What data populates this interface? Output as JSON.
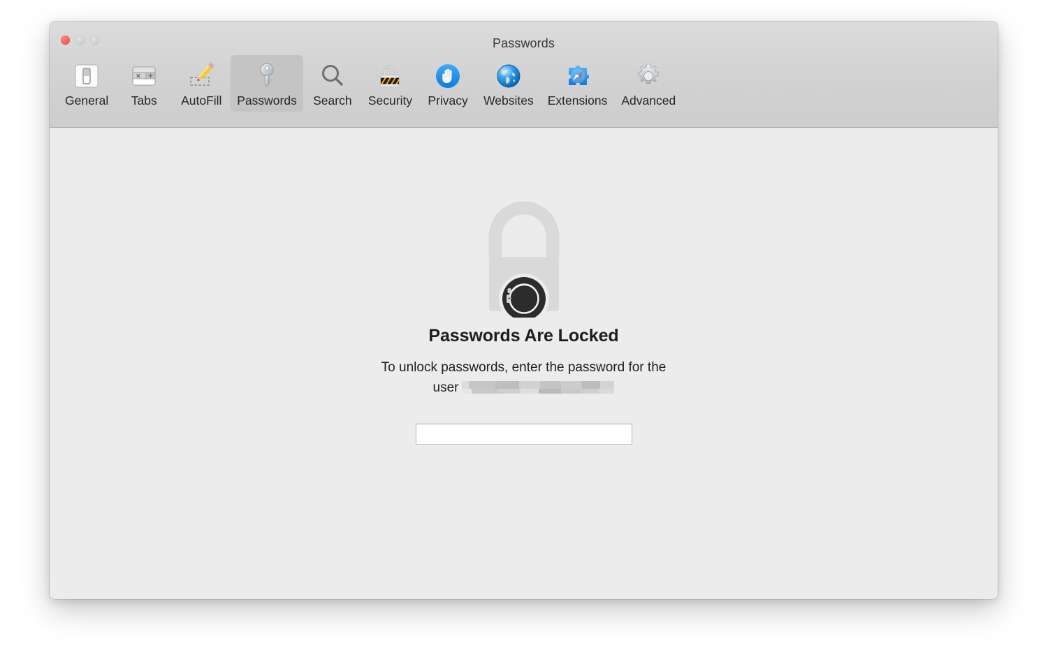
{
  "window": {
    "title": "Passwords",
    "traffic_lights": [
      {
        "name": "close",
        "color": "#ff5f57",
        "enabled": true
      },
      {
        "name": "minimize",
        "color": "#d2d2d2",
        "enabled": false
      },
      {
        "name": "zoom",
        "color": "#d2d2d2",
        "enabled": false
      }
    ]
  },
  "toolbar": {
    "selected": "Passwords",
    "items": [
      {
        "label": "General",
        "icon": "switch-icon"
      },
      {
        "label": "Tabs",
        "icon": "tabs-icon"
      },
      {
        "label": "AutoFill",
        "icon": "pencil-icon"
      },
      {
        "label": "Passwords",
        "icon": "key-icon"
      },
      {
        "label": "Search",
        "icon": "magnifier-icon"
      },
      {
        "label": "Security",
        "icon": "padlock-hazard-icon"
      },
      {
        "label": "Privacy",
        "icon": "hand-icon"
      },
      {
        "label": "Websites",
        "icon": "globe-icon"
      },
      {
        "label": "Extensions",
        "icon": "puzzle-compass-icon"
      },
      {
        "label": "Advanced",
        "icon": "gear-icon"
      }
    ]
  },
  "content": {
    "lock_icon": "locked-padlock-with-watch-icon",
    "title": "Passwords Are Locked",
    "description_line1": "To unlock passwords, enter the password for the",
    "description_line2": "user",
    "username_redacted": true,
    "password_input": {
      "value": "",
      "placeholder": ""
    }
  },
  "colors": {
    "window_background": "#ececec",
    "toolbar_top": "#dcdcdc",
    "toolbar_bottom": "#cdcdcd",
    "selected_tab": "#c4c4c4",
    "title_text": "#3a3a3a",
    "body_text": "#1d1d1d",
    "lock_body": "#d6d6d6",
    "watch_badge": "#2b2b2b",
    "accent_blue": "#1d8fef",
    "hazard_orange": "#f6a623"
  }
}
